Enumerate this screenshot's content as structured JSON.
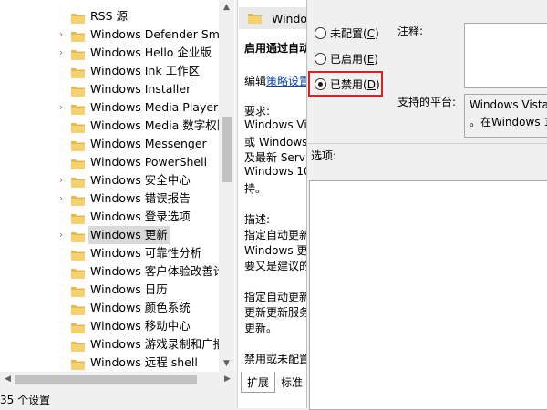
{
  "tree": {
    "items": [
      {
        "label": "RSS 源",
        "expandable": false
      },
      {
        "label": "Windows Defender Sma",
        "expandable": true
      },
      {
        "label": "Windows Hello 企业版",
        "expandable": true
      },
      {
        "label": "Windows Ink 工作区",
        "expandable": false
      },
      {
        "label": "Windows Installer",
        "expandable": false
      },
      {
        "label": "Windows Media Player",
        "expandable": true
      },
      {
        "label": "Windows Media 数字权限",
        "expandable": false
      },
      {
        "label": "Windows Messenger",
        "expandable": false
      },
      {
        "label": "Windows PowerShell",
        "expandable": false
      },
      {
        "label": "Windows 安全中心",
        "expandable": true
      },
      {
        "label": "Windows 错误报告",
        "expandable": true
      },
      {
        "label": "Windows 登录选项",
        "expandable": false
      },
      {
        "label": "Windows 更新",
        "expandable": true,
        "selected": true
      },
      {
        "label": "Windows 可靠性分析",
        "expandable": false
      },
      {
        "label": "Windows 客户体验改善计",
        "expandable": false
      },
      {
        "label": "Windows 日历",
        "expandable": false
      },
      {
        "label": "Windows 颜色系统",
        "expandable": false
      },
      {
        "label": "Windows 移动中心",
        "expandable": false
      },
      {
        "label": "Windows 游戏录制和广播",
        "expandable": false
      },
      {
        "label": "Windows 远程 shell",
        "expandable": false
      }
    ]
  },
  "status": {
    "text": "35 个设置"
  },
  "middle": {
    "header": "Windo",
    "title": "启用通过自动",
    "edit_prefix": "编辑",
    "edit_link": "策略设置",
    "req_label": "要求:",
    "req_lines": [
      "Windows Vi",
      "或 Windows",
      "及最新 Servi",
      "Windows 10",
      "持。"
    ],
    "desc_label": "描述:",
    "desc_lines": [
      "指定自动更新",
      "Windows 更",
      "要又是建议的"
    ],
    "desc2_lines": [
      "指定自动更新",
      "更新更新服务",
      "更新。"
    ],
    "desc3_lines": [
      "禁用或未配置"
    ],
    "tabs": [
      "扩展",
      "标准"
    ]
  },
  "dialog": {
    "radio_not_configured": {
      "text": "未配置(",
      "key": "C",
      "end": ")"
    },
    "radio_enabled": {
      "text": "已启用(",
      "key": "E",
      "end": ")"
    },
    "radio_disabled": {
      "text": "已禁用(",
      "key": "D",
      "end": ")"
    },
    "selected": "disabled",
    "comment_label": "注释:",
    "platform_label": "支持的平台:",
    "platform_lines": [
      "Windows Vista",
      "。在Windows 1"
    ],
    "options_label": "选项:",
    "highlight_color": "#e02020"
  }
}
